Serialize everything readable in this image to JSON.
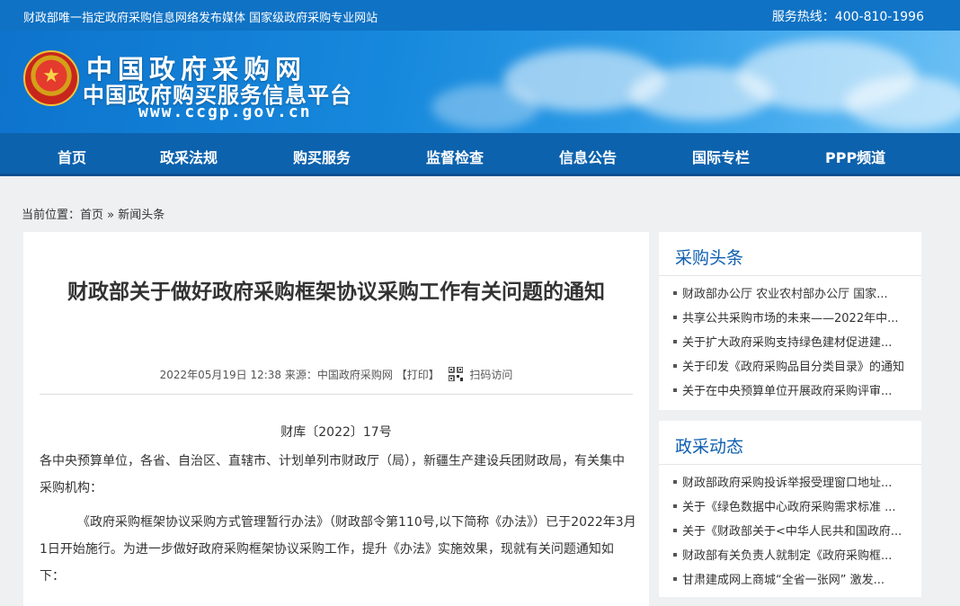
{
  "topbar": {
    "left_text": "财政部唯一指定政府采购信息网络发布媒体 国家级政府采购专业网站",
    "hotline": "服务热线：400-810-1996"
  },
  "logo": {
    "title": "中国政府采购网",
    "subtitle": "中国政府购买服务信息平台",
    "url": "www.ccgp.gov.cn"
  },
  "nav": {
    "items": [
      "首页",
      "政采法规",
      "购买服务",
      "监督检查",
      "信息公告",
      "国际专栏",
      "PPP频道"
    ]
  },
  "breadcrumb": {
    "prefix": "当前位置：",
    "home": "首页",
    "sep": "»",
    "current": "新闻头条"
  },
  "article": {
    "title": "财政部关于做好政府采购框架协议采购工作有关问题的通知",
    "meta_date": "2022年05月19日 12:38",
    "meta_source": "来源：中国政府采购网",
    "print_label": "【打印】",
    "scan_label": "扫码访问",
    "doc_no": "财库〔2022〕17号",
    "para1": "各中央预算单位，各省、自治区、直辖市、计划单列市财政厅（局），新疆生产建设兵团财政局，有关集中采购机构：",
    "para2": "《政府采购框架协议采购方式管理暂行办法》（财政部令第110号,以下简称《办法》）已于2022年3月1日开始施行。为进一步做好政府采购框架协议采购工作，提升《办法》实施效果，现就有关问题通知如下："
  },
  "sidebar1": {
    "title": "采购头条",
    "items": [
      "财政部办公厅 农业农村部办公厅 国家...",
      "共享公共采购市场的未来——2022年中...",
      "关于扩大政府采购支持绿色建材促进建...",
      "关于印发《政府采购品目分类目录》的通知",
      "关于在中央预算单位开展政府采购评审..."
    ]
  },
  "sidebar2": {
    "title": "政采动态",
    "items": [
      "财政部政府采购投诉举报受理窗口地址...",
      "关于《绿色数据中心政府采购需求标准 ...",
      "关于《财政部关于<中华人民共和国政府...",
      "财政部有关负责人就制定《政府采购框...",
      "甘肃建成网上商城“全省一张网” 激发..."
    ]
  }
}
